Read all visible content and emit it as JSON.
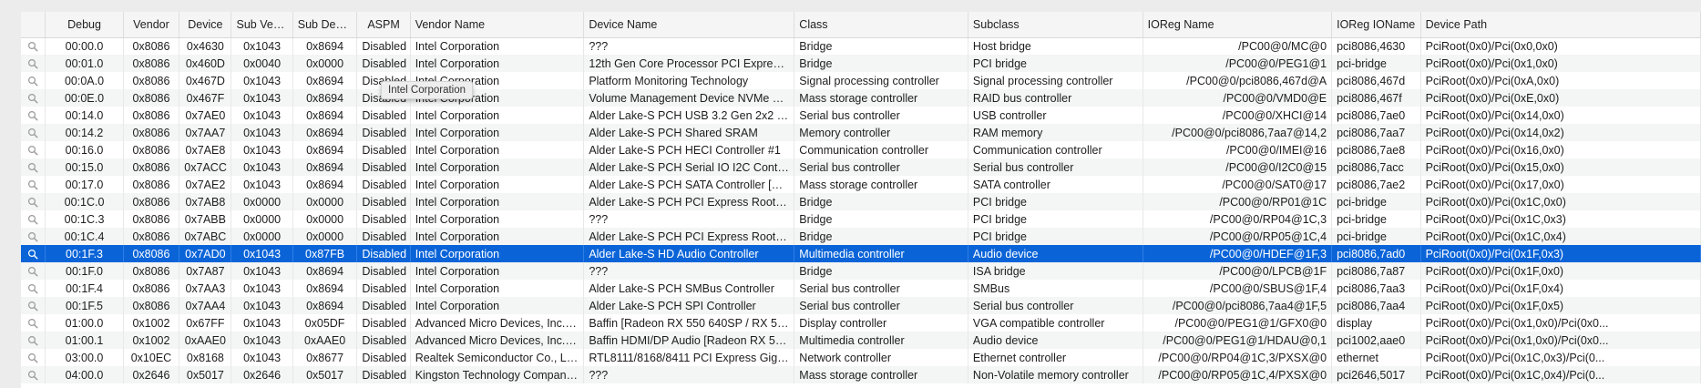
{
  "columns": {
    "debug": "Debug",
    "vendor": "Vendor",
    "device": "Device",
    "sub_vendor": "Sub Ven...",
    "sub_device": "Sub Devi...",
    "aspm": "ASPM",
    "vendor_name": "Vendor Name",
    "device_name": "Device Name",
    "class": "Class",
    "subclass": "Subclass",
    "ioreg_name": "IOReg Name",
    "ioreg_ioname": "IOReg IOName",
    "device_path": "Device Path"
  },
  "rows": [
    {
      "debug": "00:00.0",
      "vendor": "0x8086",
      "device": "0x4630",
      "sub_vendor": "0x1043",
      "sub_device": "0x8694",
      "aspm": "Disabled",
      "vendor_name": "Intel Corporation",
      "device_name": "???",
      "class": "Bridge",
      "subclass": "Host bridge",
      "ioreg_name": "/PC00@0/MC@0",
      "ioreg_ioname": "pci8086,4630",
      "device_path": "PciRoot(0x0)/Pci(0x0,0x0)"
    },
    {
      "debug": "00:01.0",
      "vendor": "0x8086",
      "device": "0x460D",
      "sub_vendor": "0x0040",
      "sub_device": "0x0000",
      "aspm": "Disabled",
      "vendor_name": "Intel Corporation",
      "device_name": "12th Gen Core Processor PCI Express x...",
      "class": "Bridge",
      "subclass": "PCI bridge",
      "ioreg_name": "/PC00@0/PEG1@1",
      "ioreg_ioname": "pci-bridge",
      "device_path": "PciRoot(0x0)/Pci(0x1,0x0)"
    },
    {
      "debug": "00:0A.0",
      "vendor": "0x8086",
      "device": "0x467D",
      "sub_vendor": "0x1043",
      "sub_device": "0x8694",
      "aspm": "Disabled",
      "vendor_name": "Intel Corporation",
      "device_name": "Platform Monitoring Technology",
      "class": "Signal processing controller",
      "subclass": "Signal processing controller",
      "ioreg_name": "/PC00@0/pci8086,467d@A",
      "ioreg_ioname": "pci8086,467d",
      "device_path": "PciRoot(0x0)/Pci(0xA,0x0)"
    },
    {
      "debug": "00:0E.0",
      "vendor": "0x8086",
      "device": "0x467F",
      "sub_vendor": "0x1043",
      "sub_device": "0x8694",
      "aspm": "Disabled",
      "vendor_name": "Intel Corporation",
      "device_name": "Volume Management Device NVMe RAI...",
      "class": "Mass storage controller",
      "subclass": "RAID bus controller",
      "ioreg_name": "/PC00@0/VMD0@E",
      "ioreg_ioname": "pci8086,467f",
      "device_path": "PciRoot(0x0)/Pci(0xE,0x0)"
    },
    {
      "debug": "00:14.0",
      "vendor": "0x8086",
      "device": "0x7AE0",
      "sub_vendor": "0x1043",
      "sub_device": "0x8694",
      "aspm": "Disabled",
      "vendor_name": "Intel Corporation",
      "device_name": "Alder Lake-S PCH USB 3.2 Gen 2x2 XH...",
      "class": "Serial bus controller",
      "subclass": "USB controller",
      "ioreg_name": "/PC00@0/XHCI@14",
      "ioreg_ioname": "pci8086,7ae0",
      "device_path": "PciRoot(0x0)/Pci(0x14,0x0)"
    },
    {
      "debug": "00:14.2",
      "vendor": "0x8086",
      "device": "0x7AA7",
      "sub_vendor": "0x1043",
      "sub_device": "0x8694",
      "aspm": "Disabled",
      "vendor_name": "Intel Corporation",
      "device_name": "Alder Lake-S PCH Shared SRAM",
      "class": "Memory controller",
      "subclass": "RAM memory",
      "ioreg_name": "/PC00@0/pci8086,7aa7@14,2",
      "ioreg_ioname": "pci8086,7aa7",
      "device_path": "PciRoot(0x0)/Pci(0x14,0x2)"
    },
    {
      "debug": "00:16.0",
      "vendor": "0x8086",
      "device": "0x7AE8",
      "sub_vendor": "0x1043",
      "sub_device": "0x8694",
      "aspm": "Disabled",
      "vendor_name": "Intel Corporation",
      "device_name": "Alder Lake-S PCH HECI Controller #1",
      "class": "Communication controller",
      "subclass": "Communication controller",
      "ioreg_name": "/PC00@0/IMEI@16",
      "ioreg_ioname": "pci8086,7ae8",
      "device_path": "PciRoot(0x0)/Pci(0x16,0x0)"
    },
    {
      "debug": "00:15.0",
      "vendor": "0x8086",
      "device": "0x7ACC",
      "sub_vendor": "0x1043",
      "sub_device": "0x8694",
      "aspm": "Disabled",
      "vendor_name": "Intel Corporation",
      "device_name": "Alder Lake-S PCH Serial IO I2C Controll...",
      "class": "Serial bus controller",
      "subclass": "Serial bus controller",
      "ioreg_name": "/PC00@0/I2C0@15",
      "ioreg_ioname": "pci8086,7acc",
      "device_path": "PciRoot(0x0)/Pci(0x15,0x0)"
    },
    {
      "debug": "00:17.0",
      "vendor": "0x8086",
      "device": "0x7AE2",
      "sub_vendor": "0x1043",
      "sub_device": "0x8694",
      "aspm": "Disabled",
      "vendor_name": "Intel Corporation",
      "device_name": "Alder Lake-S PCH SATA Controller [AH...",
      "class": "Mass storage controller",
      "subclass": "SATA controller",
      "ioreg_name": "/PC00@0/SAT0@17",
      "ioreg_ioname": "pci8086,7ae2",
      "device_path": "PciRoot(0x0)/Pci(0x17,0x0)"
    },
    {
      "debug": "00:1C.0",
      "vendor": "0x8086",
      "device": "0x7AB8",
      "sub_vendor": "0x0000",
      "sub_device": "0x0000",
      "aspm": "Disabled",
      "vendor_name": "Intel Corporation",
      "device_name": "Alder Lake-S PCH PCI Express Root Por...",
      "class": "Bridge",
      "subclass": "PCI bridge",
      "ioreg_name": "/PC00@0/RP01@1C",
      "ioreg_ioname": "pci-bridge",
      "device_path": "PciRoot(0x0)/Pci(0x1C,0x0)"
    },
    {
      "debug": "00:1C.3",
      "vendor": "0x8086",
      "device": "0x7ABB",
      "sub_vendor": "0x0000",
      "sub_device": "0x0000",
      "aspm": "Disabled",
      "vendor_name": "Intel Corporation",
      "device_name": "???",
      "class": "Bridge",
      "subclass": "PCI bridge",
      "ioreg_name": "/PC00@0/RP04@1C,3",
      "ioreg_ioname": "pci-bridge",
      "device_path": "PciRoot(0x0)/Pci(0x1C,0x3)"
    },
    {
      "debug": "00:1C.4",
      "vendor": "0x8086",
      "device": "0x7ABC",
      "sub_vendor": "0x0000",
      "sub_device": "0x0000",
      "aspm": "Disabled",
      "vendor_name": "Intel Corporation",
      "device_name": "Alder Lake-S PCH PCI Express Root Por...",
      "class": "Bridge",
      "subclass": "PCI bridge",
      "ioreg_name": "/PC00@0/RP05@1C,4",
      "ioreg_ioname": "pci-bridge",
      "device_path": "PciRoot(0x0)/Pci(0x1C,0x4)"
    },
    {
      "debug": "00:1F.3",
      "vendor": "0x8086",
      "device": "0x7AD0",
      "sub_vendor": "0x1043",
      "sub_device": "0x87FB",
      "aspm": "Disabled",
      "vendor_name": "Intel Corporation",
      "device_name": "Alder Lake-S HD Audio Controller",
      "class": "Multimedia controller",
      "subclass": "Audio device",
      "ioreg_name": "/PC00@0/HDEF@1F,3",
      "ioreg_ioname": "pci8086,7ad0",
      "device_path": "PciRoot(0x0)/Pci(0x1F,0x3)",
      "selected": true
    },
    {
      "debug": "00:1F.0",
      "vendor": "0x8086",
      "device": "0x7A87",
      "sub_vendor": "0x1043",
      "sub_device": "0x8694",
      "aspm": "Disabled",
      "vendor_name": "Intel Corporation",
      "device_name": "???",
      "class": "Bridge",
      "subclass": "ISA bridge",
      "ioreg_name": "/PC00@0/LPCB@1F",
      "ioreg_ioname": "pci8086,7a87",
      "device_path": "PciRoot(0x0)/Pci(0x1F,0x0)"
    },
    {
      "debug": "00:1F.4",
      "vendor": "0x8086",
      "device": "0x7AA3",
      "sub_vendor": "0x1043",
      "sub_device": "0x8694",
      "aspm": "Disabled",
      "vendor_name": "Intel Corporation",
      "device_name": "Alder Lake-S PCH SMBus Controller",
      "class": "Serial bus controller",
      "subclass": "SMBus",
      "ioreg_name": "/PC00@0/SBUS@1F,4",
      "ioreg_ioname": "pci8086,7aa3",
      "device_path": "PciRoot(0x0)/Pci(0x1F,0x4)"
    },
    {
      "debug": "00:1F.5",
      "vendor": "0x8086",
      "device": "0x7AA4",
      "sub_vendor": "0x1043",
      "sub_device": "0x8694",
      "aspm": "Disabled",
      "vendor_name": "Intel Corporation",
      "device_name": "Alder Lake-S PCH SPI Controller",
      "class": "Serial bus controller",
      "subclass": "Serial bus controller",
      "ioreg_name": "/PC00@0/pci8086,7aa4@1F,5",
      "ioreg_ioname": "pci8086,7aa4",
      "device_path": "PciRoot(0x0)/Pci(0x1F,0x5)"
    },
    {
      "debug": "01:00.0",
      "vendor": "0x1002",
      "device": "0x67FF",
      "sub_vendor": "0x1043",
      "sub_device": "0x05DF",
      "aspm": "Disabled",
      "vendor_name": "Advanced Micro Devices, Inc. [A...",
      "device_name": "Baffin [Radeon RX 550 640SP / RX 560...",
      "class": "Display controller",
      "subclass": "VGA compatible controller",
      "ioreg_name": "/PC00@0/PEG1@1/GFX0@0",
      "ioreg_ioname": "display",
      "device_path": "PciRoot(0x0)/Pci(0x1,0x0)/Pci(0x0..."
    },
    {
      "debug": "01:00.1",
      "vendor": "0x1002",
      "device": "0xAAE0",
      "sub_vendor": "0x1043",
      "sub_device": "0xAAE0",
      "aspm": "Disabled",
      "vendor_name": "Advanced Micro Devices, Inc. [A...",
      "device_name": "Baffin HDMI/DP Audio [Radeon RX 550...",
      "class": "Multimedia controller",
      "subclass": "Audio device",
      "ioreg_name": "/PC00@0/PEG1@1/HDAU@0,1",
      "ioreg_ioname": "pci1002,aae0",
      "device_path": "PciRoot(0x0)/Pci(0x1,0x0)/Pci(0x0..."
    },
    {
      "debug": "03:00.0",
      "vendor": "0x10EC",
      "device": "0x8168",
      "sub_vendor": "0x1043",
      "sub_device": "0x8677",
      "aspm": "Disabled",
      "vendor_name": "Realtek Semiconductor Co., Ltd.",
      "device_name": "RTL8111/8168/8411 PCI Express Gigabit...",
      "class": "Network controller",
      "subclass": "Ethernet controller",
      "ioreg_name": "/PC00@0/RP04@1C,3/PXSX@0",
      "ioreg_ioname": "ethernet",
      "device_path": "PciRoot(0x0)/Pci(0x1C,0x3)/Pci(0..."
    },
    {
      "debug": "04:00.0",
      "vendor": "0x2646",
      "device": "0x5017",
      "sub_vendor": "0x2646",
      "sub_device": "0x5017",
      "aspm": "Disabled",
      "vendor_name": "Kingston Technology Company, I...",
      "device_name": "???",
      "class": "Mass storage controller",
      "subclass": "Non-Volatile memory controller",
      "ioreg_name": "/PC00@0/RP05@1C,4/PXSX@0",
      "ioreg_ioname": "pci2646,5017",
      "device_path": "PciRoot(0x0)/Pci(0x1C,0x4)/Pci(0..."
    }
  ],
  "tooltip": {
    "text": "Intel Corporation"
  },
  "colors": {
    "selection": "#0a64d8",
    "header_bg": "#f5f5f5",
    "stripe": "#f4f5f5"
  },
  "icons": {
    "row_icon": "magnifier-icon"
  }
}
